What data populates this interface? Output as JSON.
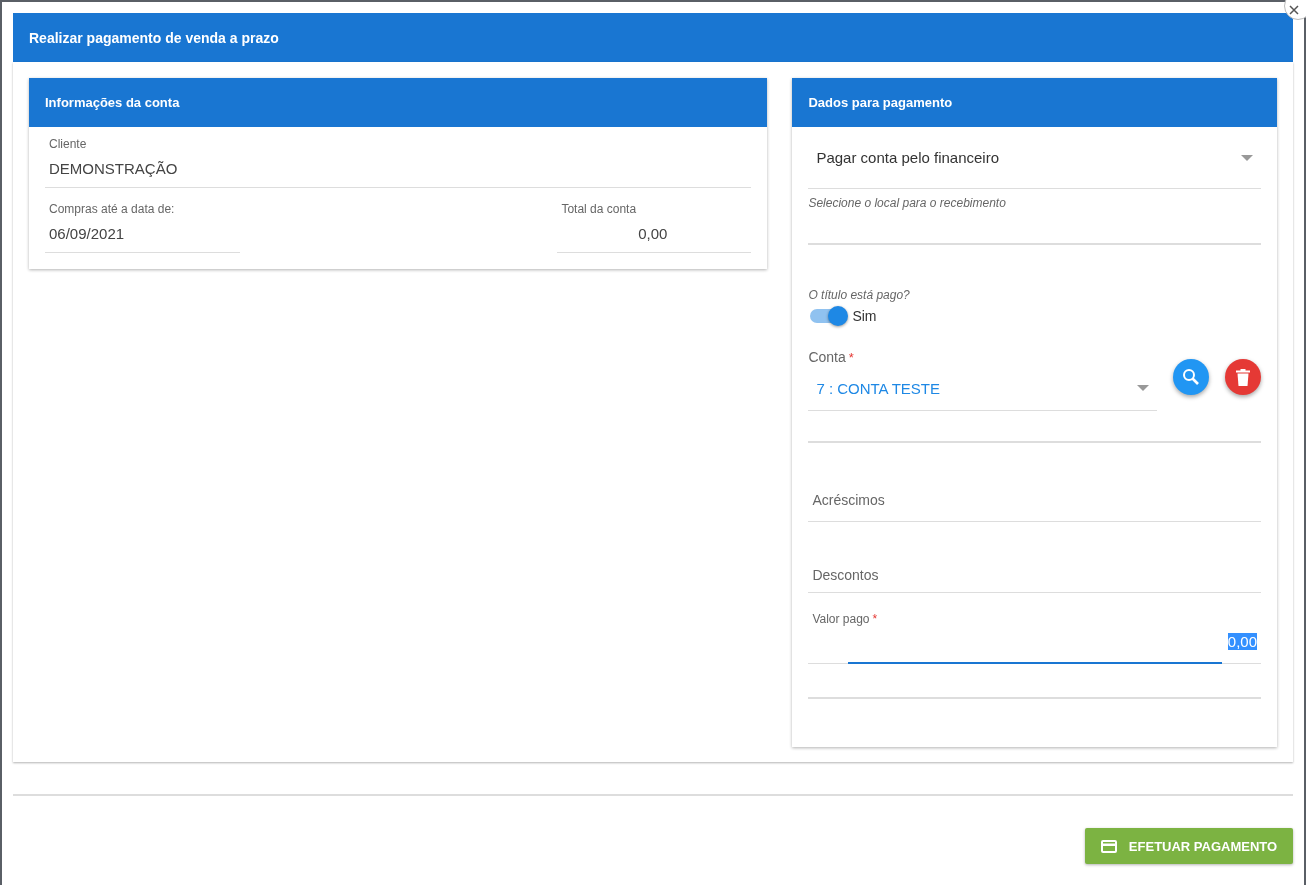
{
  "dialog": {
    "title": "Realizar pagamento de venda a prazo"
  },
  "account_info": {
    "title": "Informações da conta",
    "client": {
      "label": "Cliente",
      "value": "DEMONSTRAÇÃO"
    },
    "date": {
      "label": "Compras até a data de:",
      "value": "06/09/2021"
    },
    "total": {
      "label": "Total da conta",
      "value": "0,00"
    }
  },
  "payment": {
    "title": "Dados para pagamento",
    "payment_place": {
      "value": "Pagar conta pelo financeiro",
      "hint": "Selecione o local para o recebimento"
    },
    "paid_toggle": {
      "label": "O título está pago?",
      "on": true,
      "text": "Sim"
    },
    "account": {
      "label": "Conta",
      "required_mark": "*",
      "value": "7 : CONTA TESTE"
    },
    "fields": [
      {
        "placeholder": "Acréscimos"
      },
      {
        "placeholder": "Descontos"
      }
    ],
    "amount_paid": {
      "label": "Valor pago",
      "required_mark": "*",
      "value": "0,00"
    }
  },
  "submit_button": {
    "label": "EFETUAR PAGAMENTO"
  }
}
